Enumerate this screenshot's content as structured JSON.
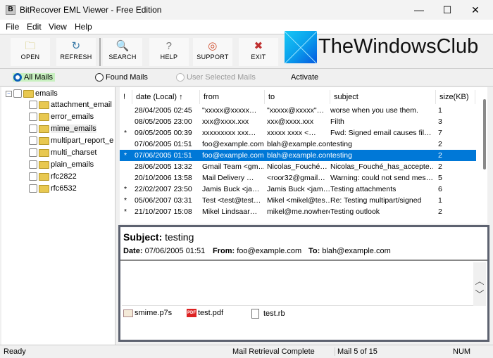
{
  "window": {
    "title": "BitRecover EML Viewer - Free Edition",
    "app_icon_letter": "B",
    "minimize": "—",
    "maximize": "☐",
    "close": "✕"
  },
  "menu": [
    "File",
    "Edit",
    "View",
    "Help"
  ],
  "toolbar": [
    {
      "label": "OPEN",
      "icon": "folder-open-icon",
      "glyph": "🗀",
      "color": "#c8b84a"
    },
    {
      "label": "REFRESH",
      "icon": "refresh-icon",
      "glyph": "↻",
      "color": "#3a7aa8"
    },
    {
      "label": "SEARCH",
      "icon": "search-icon",
      "glyph": "🔍",
      "color": "#555"
    },
    {
      "label": "HELP",
      "icon": "help-icon",
      "glyph": "?",
      "color": "#777"
    },
    {
      "label": "SUPPORT",
      "icon": "lifebuoy-icon",
      "glyph": "◎",
      "color": "#d05030"
    },
    {
      "label": "EXIT",
      "icon": "exit-icon",
      "glyph": "✖",
      "color": "#c03030"
    }
  ],
  "watermark": "TheWindowsClub",
  "filters": {
    "all": "All Mails",
    "found": "Found Mails",
    "selected": "User Selected Mails",
    "activate": "Activate",
    "checked": "all"
  },
  "tree": {
    "root": "emails",
    "children": [
      "attachment_email",
      "error_emails",
      "mime_emails",
      "multipart_report_e",
      "multi_charset",
      "plain_emails",
      "rfc2822",
      "rfc6532"
    ],
    "selected": "mime_emails"
  },
  "list": {
    "columns": [
      "!",
      "date (Local) ↑",
      "from",
      "to",
      "subject",
      "size(KB)"
    ],
    "rows": [
      [
        "",
        "28/04/2005 02:45",
        "\"xxxxx@xxxxx…",
        "\"xxxxx@xxxxx\"…",
        "worse when you use them.",
        "1"
      ],
      [
        "",
        "08/05/2005 23:00",
        "xxx@xxxx.xxx",
        "xxx@xxxx.xxx",
        "Filth",
        "3"
      ],
      [
        "*",
        "09/05/2005 00:39",
        "xxxxxxxxx xxx…",
        "xxxxx xxxx <…",
        "Fwd: Signed email causes fil…",
        "7"
      ],
      [
        "",
        "07/06/2005 01:51",
        "foo@example.com",
        "blah@example.com",
        "testing",
        "2"
      ],
      [
        "*",
        "07/06/2005 01:51",
        "foo@example.com",
        "blah@example.com",
        "testing",
        "2"
      ],
      [
        "",
        "28/06/2005 13:32",
        "Gmail Team <gm…",
        "Nicolas_Fouché…",
        "Nicolas_Fouché_has_accepte…",
        "2"
      ],
      [
        "",
        "20/10/2006 13:58",
        "Mail Delivery …",
        "<roor32@gmail…",
        "Warning: could not send mes…",
        "5"
      ],
      [
        "*",
        "22/02/2007 23:50",
        "Jamis Buck <ja…",
        "Jamis Buck <jam…",
        "Testing attachments",
        "6"
      ],
      [
        "*",
        "05/06/2007 03:31",
        "Test <test@test…",
        "Mikel <mikel@tes…",
        "Re: Testing multipart/signed",
        "1"
      ],
      [
        "*",
        "21/10/2007 15:08",
        "Mikel Lindsaar…",
        "mikel@me.nowhere",
        "Testing outlook",
        "2"
      ]
    ],
    "selected_index": 4,
    "selection_color": "#0078d7"
  },
  "preview": {
    "subject_label": "Subject:",
    "subject": "testing",
    "date_label": "Date:",
    "date": "07/06/2005 01:51",
    "from_label": "From:",
    "from": "foo@example.com",
    "to_label": "To:",
    "to": "blah@example.com",
    "attachments": [
      {
        "name": "smime.p7s",
        "icon": "certificate-icon"
      },
      {
        "name": "test.pdf",
        "icon": "pdf-icon"
      },
      {
        "name": "test.rb",
        "icon": "file-icon"
      }
    ]
  },
  "status": {
    "left": "Ready",
    "middle": "Mail Retrieval Complete",
    "count": "Mail 5 of 15",
    "num": "NUM"
  }
}
